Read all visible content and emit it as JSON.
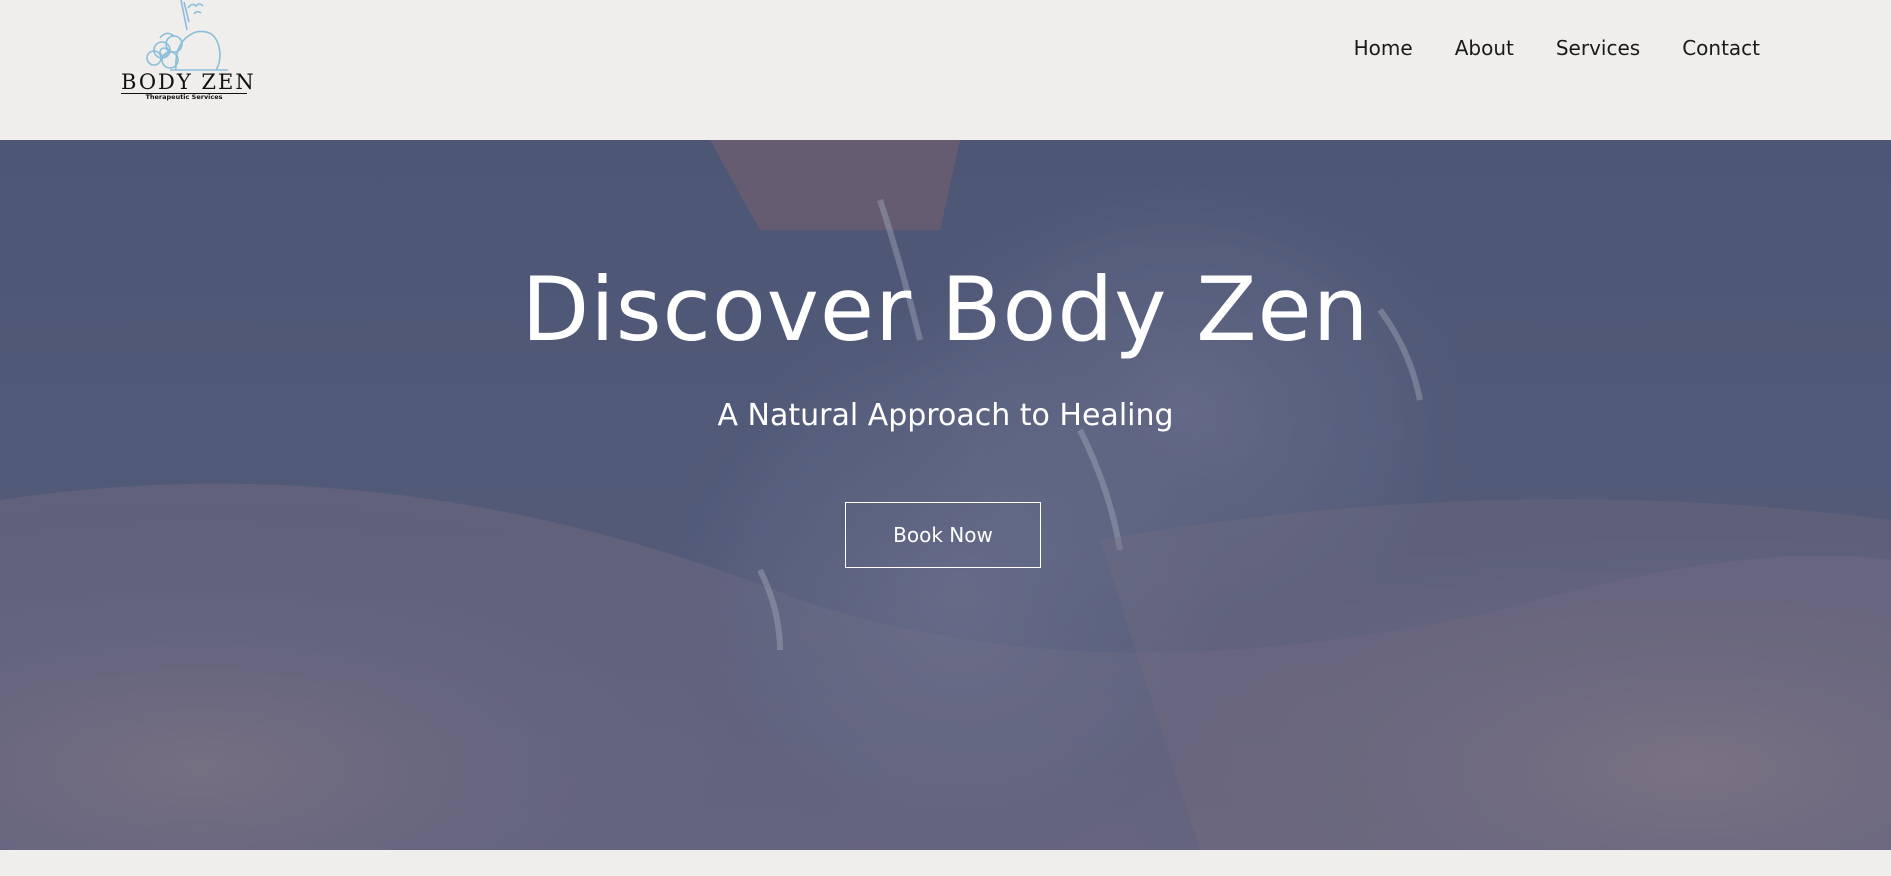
{
  "brand": {
    "name": "Body Zen",
    "tagline": "Therapeutic Services"
  },
  "nav": {
    "items": [
      {
        "label": "Home"
      },
      {
        "label": "About"
      },
      {
        "label": "Services"
      },
      {
        "label": "Contact"
      }
    ]
  },
  "hero": {
    "title": "Discover Body Zen",
    "subtitle": "A Natural Approach to Healing",
    "cta_label": "Book Now"
  },
  "colors": {
    "header_bg": "#efeeec",
    "hero_overlay": "#4a5373",
    "logo_accent": "#8bbfd9",
    "text_dark": "#1a1a1a",
    "text_light": "#ffffff"
  }
}
